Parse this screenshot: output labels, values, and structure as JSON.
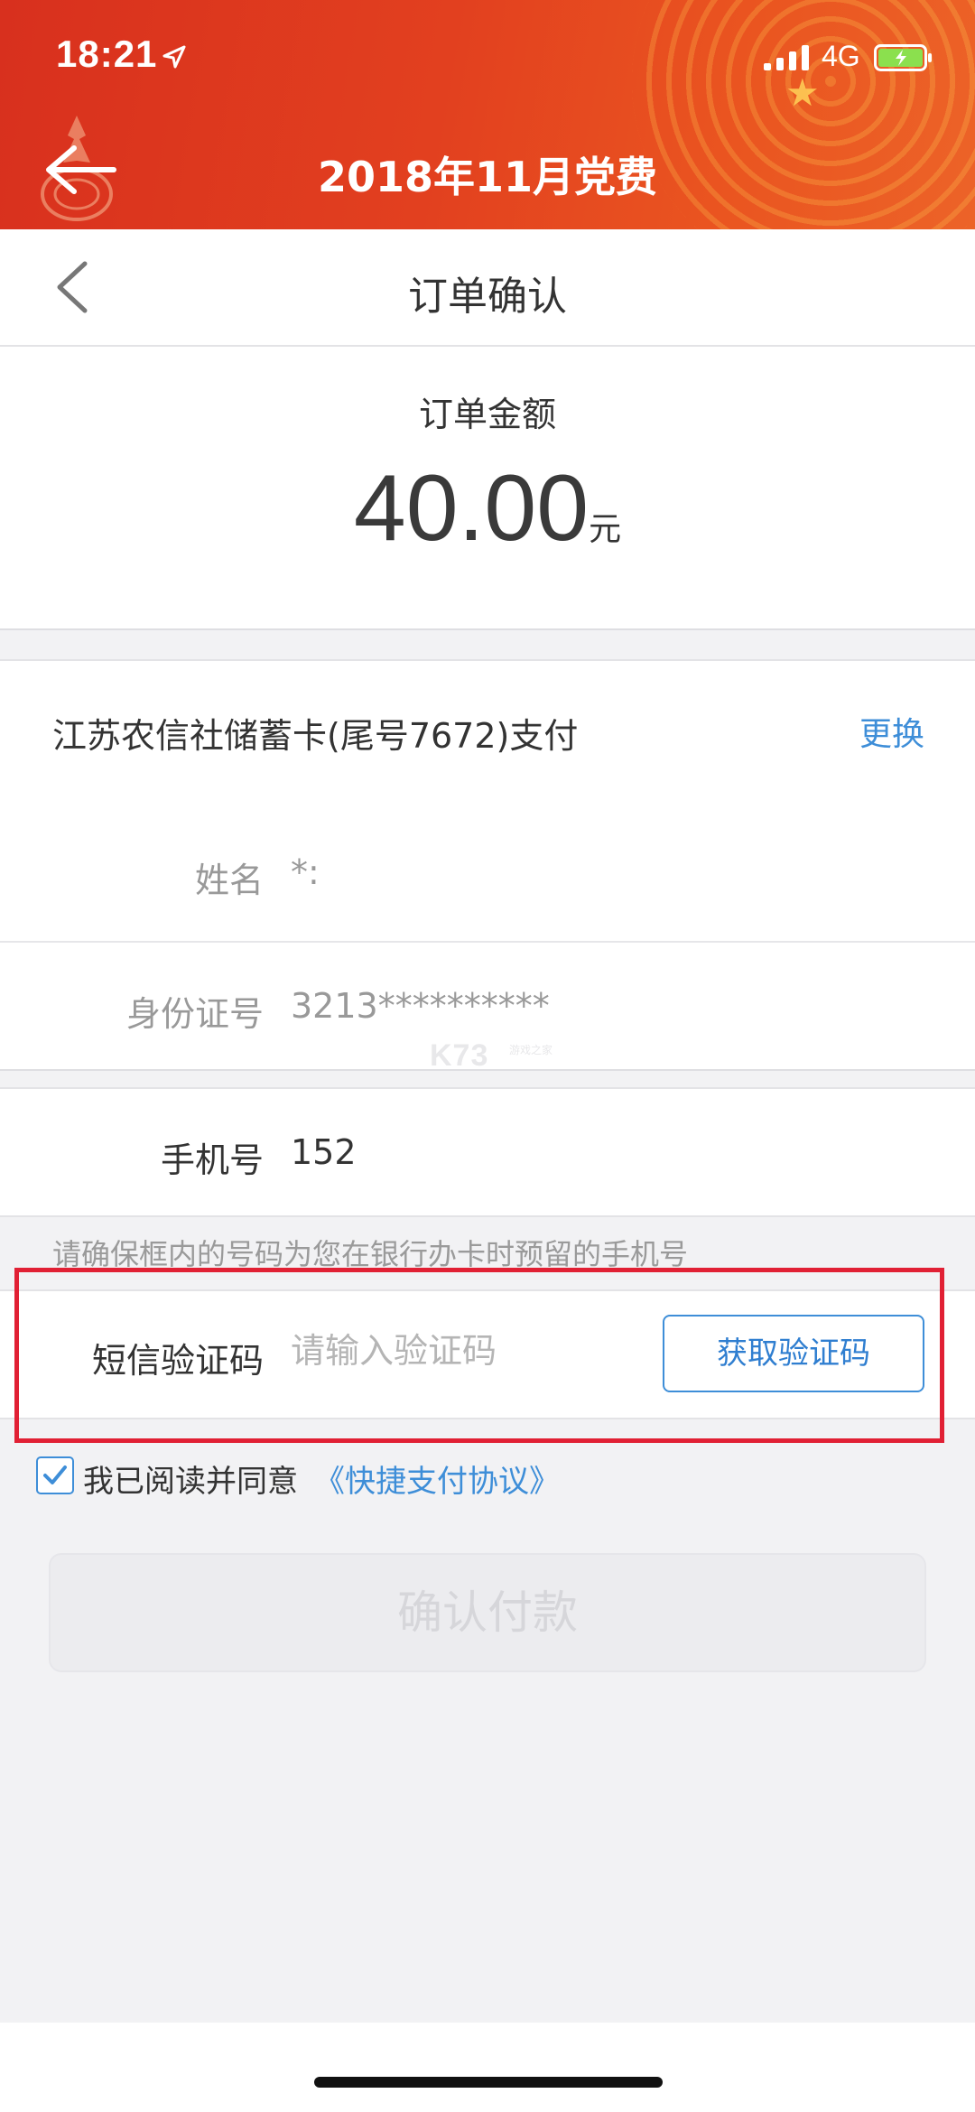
{
  "status_bar": {
    "time": "18:21",
    "network": "4G"
  },
  "header": {
    "title": "2018年11月党费"
  },
  "nav": {
    "title": "订单确认"
  },
  "amount": {
    "label": "订单金额",
    "value": "40.00",
    "unit": "元"
  },
  "card": {
    "text": "江苏农信社储蓄卡(尾号7672)支付",
    "change_label": "更换"
  },
  "form": {
    "name_label": "姓名",
    "name_value": "*:",
    "id_label": "身份证号",
    "id_value": "3213**********",
    "phone_label": "手机号",
    "phone_value": "152",
    "hint": "请确保框内的号码为您在银行办卡时预留的手机号",
    "sms_label": "短信验证码",
    "sms_placeholder": "请输入验证码",
    "get_code_label": "获取验证码"
  },
  "agreement": {
    "text": "我已阅读并同意",
    "link": "《快捷支付协议》",
    "checked": true
  },
  "confirm_label": "确认付款",
  "watermark": {
    "main": "K73",
    "sub": "游戏之家"
  },
  "colors": {
    "header_red": "#d8301e",
    "link_blue": "#3e8ed8",
    "highlight_red": "#e12034"
  }
}
